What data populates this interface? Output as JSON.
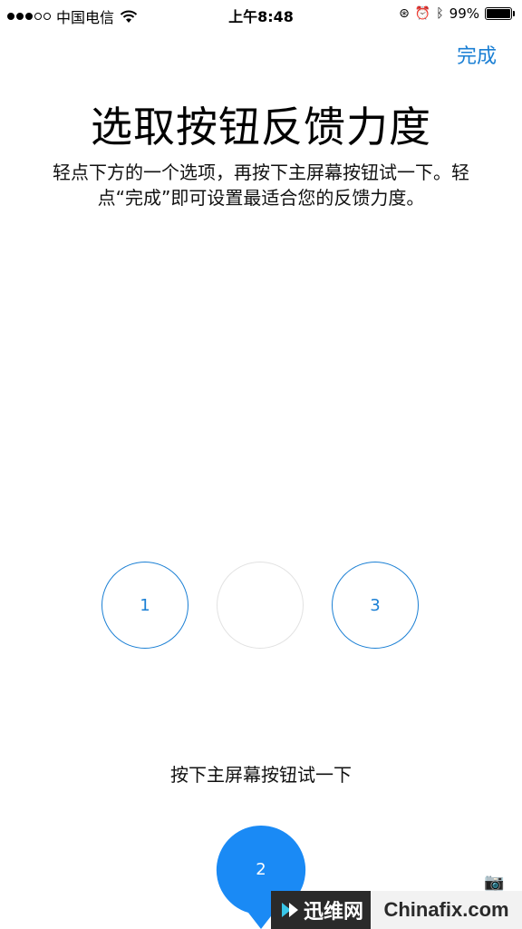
{
  "status_bar": {
    "carrier": "中国电信",
    "time": "上午8:48",
    "battery_text": "99%",
    "battery_level": 0.99,
    "signal_bars_filled": 3,
    "signal_bars_total": 5,
    "icons": [
      "wifi-icon",
      "orientation-lock-icon",
      "alarm-icon",
      "bluetooth-icon",
      "battery-icon"
    ]
  },
  "nav": {
    "done_label": "完成"
  },
  "page": {
    "title": "选取按钮反馈力度",
    "description": "轻点下方的一个选项，再按下主屏幕按钮试一下。轻点“完成”即可设置最适合您的反馈力度。",
    "instruction": "按下主屏幕按钮试一下"
  },
  "options": [
    {
      "label": "1",
      "selected": false
    },
    {
      "label": "2",
      "selected": true
    },
    {
      "label": "3",
      "selected": false
    }
  ],
  "selected_label": "2",
  "watermark": {
    "left_text": "迅维网",
    "right_text": "Chinafix.com"
  },
  "colors": {
    "accent": "#1a7fd4",
    "pin": "#1a8af5",
    "unselected_border": "#e2e2e2"
  }
}
